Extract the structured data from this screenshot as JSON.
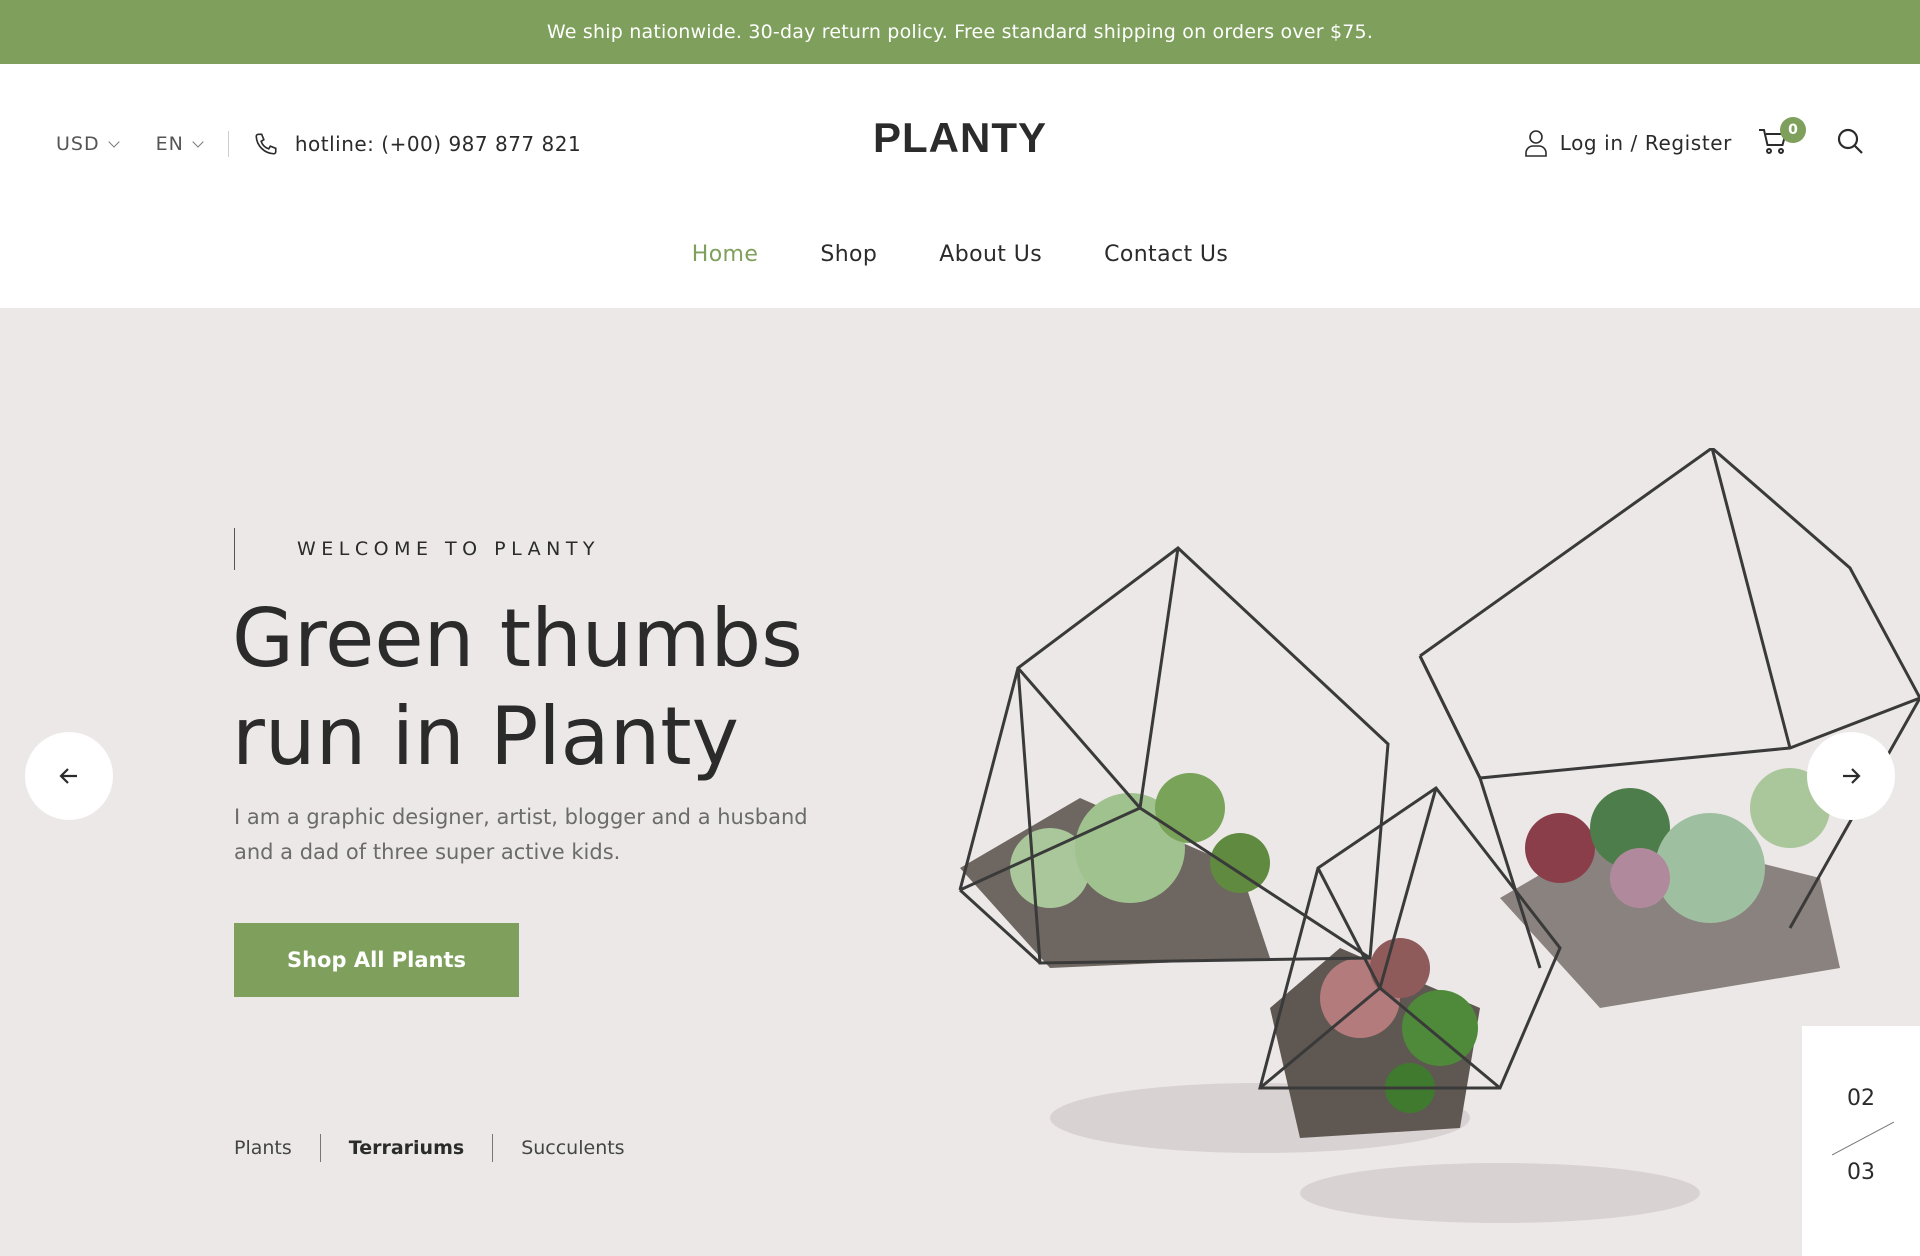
{
  "announcement": "We ship nationwide. 30-day return policy. Free standard shipping on orders over $75.",
  "header": {
    "currency": "USD",
    "language": "EN",
    "hotline": "hotline: (+00) 987 877 821",
    "logo": "PLANTY",
    "login_label": "Log in / Register",
    "cart_count": "0"
  },
  "nav": {
    "items": [
      {
        "label": "Home",
        "active": true
      },
      {
        "label": "Shop"
      },
      {
        "label": "About Us"
      },
      {
        "label": "Contact Us"
      }
    ]
  },
  "hero": {
    "eyebrow": "WELCOME TO PLANTY",
    "headline": "Green thumbs run in Planty",
    "description": "I am a graphic designer, artist, blogger and a husband and a dad of three super active kids.",
    "cta_label": "Shop All Plants",
    "categories": [
      "Plants",
      "Terrariums",
      "Succulents"
    ],
    "active_category": "Terrariums",
    "slide_current": "02",
    "slide_total": "03"
  },
  "colors": {
    "accent": "#7fa05c",
    "hero_bg": "#ede8e8",
    "text_dark": "#2b2b2b"
  },
  "icons": [
    "chevron-down-icon",
    "phone-icon",
    "user-icon",
    "cart-icon",
    "search-icon",
    "arrow-left-icon",
    "arrow-right-icon"
  ]
}
